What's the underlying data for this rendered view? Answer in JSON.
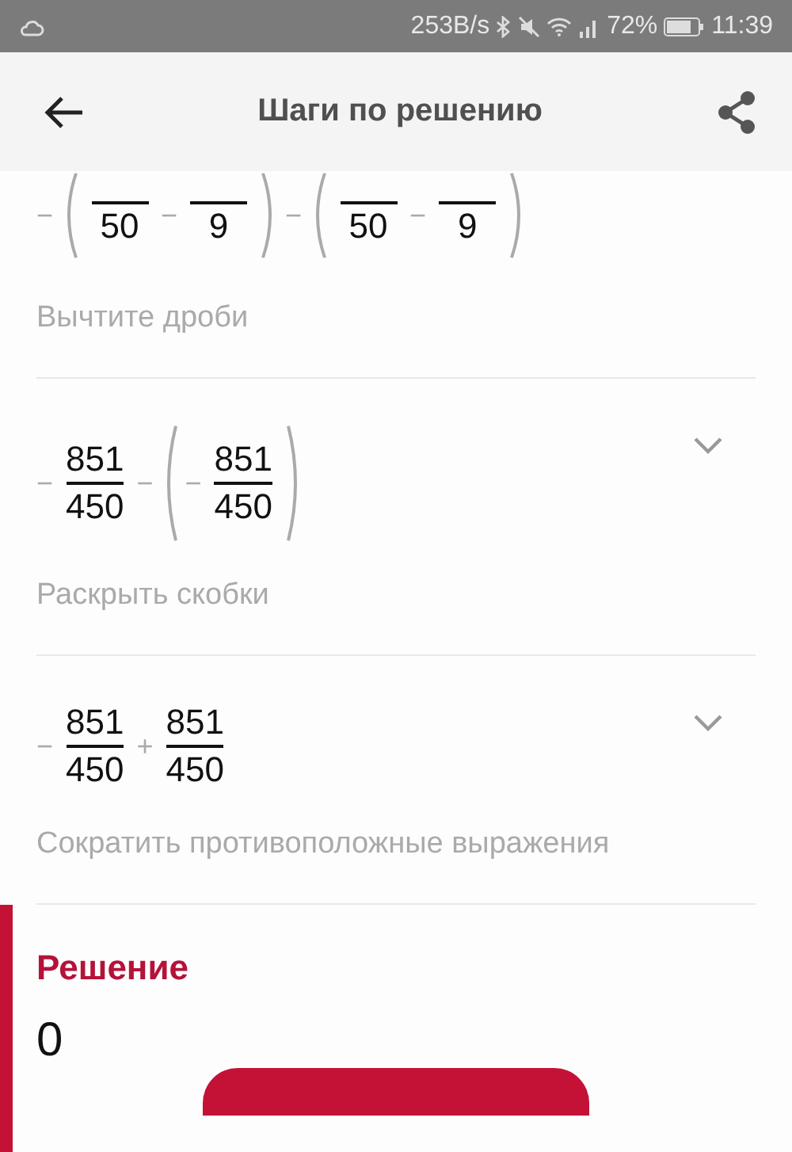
{
  "status_bar": {
    "speed": "253B/s",
    "battery": "72%",
    "time": "11:39"
  },
  "header": {
    "title": "Шаги по решению"
  },
  "steps": [
    {
      "expression": [
        {
          "kind": "op",
          "text": "−"
        },
        {
          "kind": "lparen"
        },
        {
          "kind": "fraction",
          "den": "50"
        },
        {
          "kind": "op",
          "text": "−"
        },
        {
          "kind": "fraction",
          "den": "9"
        },
        {
          "kind": "rparen"
        },
        {
          "kind": "op",
          "text": "−"
        },
        {
          "kind": "lparen"
        },
        {
          "kind": "fraction",
          "den": "50"
        },
        {
          "kind": "op",
          "text": "−"
        },
        {
          "kind": "fraction",
          "den": "9"
        },
        {
          "kind": "rparen"
        }
      ],
      "caption": "Вычтите дроби"
    },
    {
      "expression": [
        {
          "kind": "op",
          "text": "−"
        },
        {
          "kind": "fraction",
          "num": "851",
          "den": "450"
        },
        {
          "kind": "op",
          "text": "−"
        },
        {
          "kind": "lparen"
        },
        {
          "kind": "op",
          "text": "−"
        },
        {
          "kind": "fraction",
          "num": "851",
          "den": "450"
        },
        {
          "kind": "rparen"
        }
      ],
      "caption": "Раскрыть скобки",
      "expanded": false
    },
    {
      "expression": [
        {
          "kind": "op",
          "text": "−"
        },
        {
          "kind": "fraction",
          "num": "851",
          "den": "450"
        },
        {
          "kind": "op",
          "text": "+"
        },
        {
          "kind": "fraction",
          "num": "851",
          "den": "450"
        }
      ],
      "caption": "Сократить противоположные выражения",
      "expanded": false
    }
  ],
  "solution": {
    "title": "Решение",
    "value": "0"
  }
}
